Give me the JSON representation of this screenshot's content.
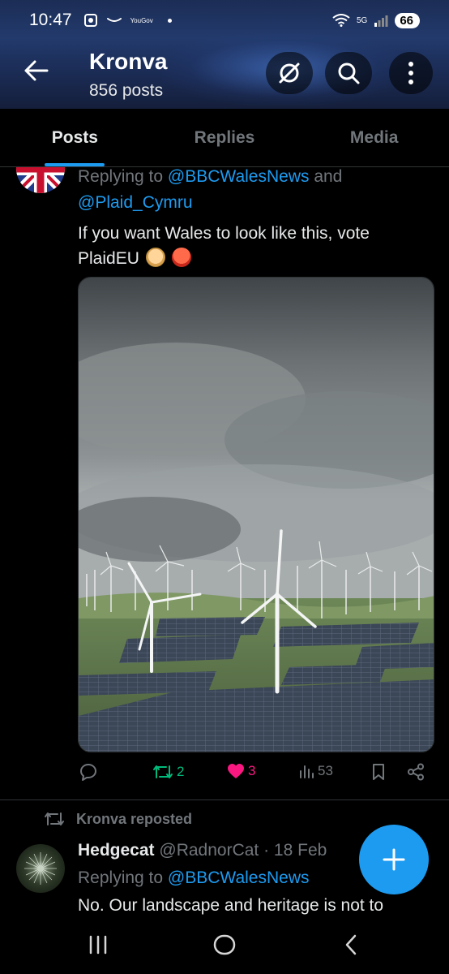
{
  "status_bar": {
    "time": "10:47",
    "app_label": "YouGov",
    "battery": "66",
    "net": "5G"
  },
  "header": {
    "title": "Kronva",
    "subtitle": "856 posts"
  },
  "tabs": [
    {
      "label": "Posts",
      "active": true
    },
    {
      "label": "Replies",
      "active": false
    },
    {
      "label": "Media",
      "active": false
    }
  ],
  "post1": {
    "reply_prefix": "Replying to",
    "mention_1": "@BBCWalesNews",
    "reply_and": "and",
    "mention_2": "@Plaid_Cymru",
    "text": "If you want Wales to look like this, vote PlaidEU",
    "image_icon": "wind-turbine-landscape",
    "actions": {
      "reply_count": "",
      "repost_count": "2",
      "like_count": "3",
      "views_count": "53"
    }
  },
  "post2": {
    "repost_label": "Kronva reposted",
    "author_name": "Hedgecat",
    "author_handle": "@RadnorCat",
    "date": "· 18 Feb",
    "reply_prefix": "Replying to",
    "mention": "@BBCWalesNews",
    "text": "No. Our landscape and heritage is not to"
  },
  "colors": {
    "accent": "#1d9bf0",
    "repost_green": "#00ba7c",
    "like_pink": "#f91880",
    "muted": "#71767b"
  }
}
